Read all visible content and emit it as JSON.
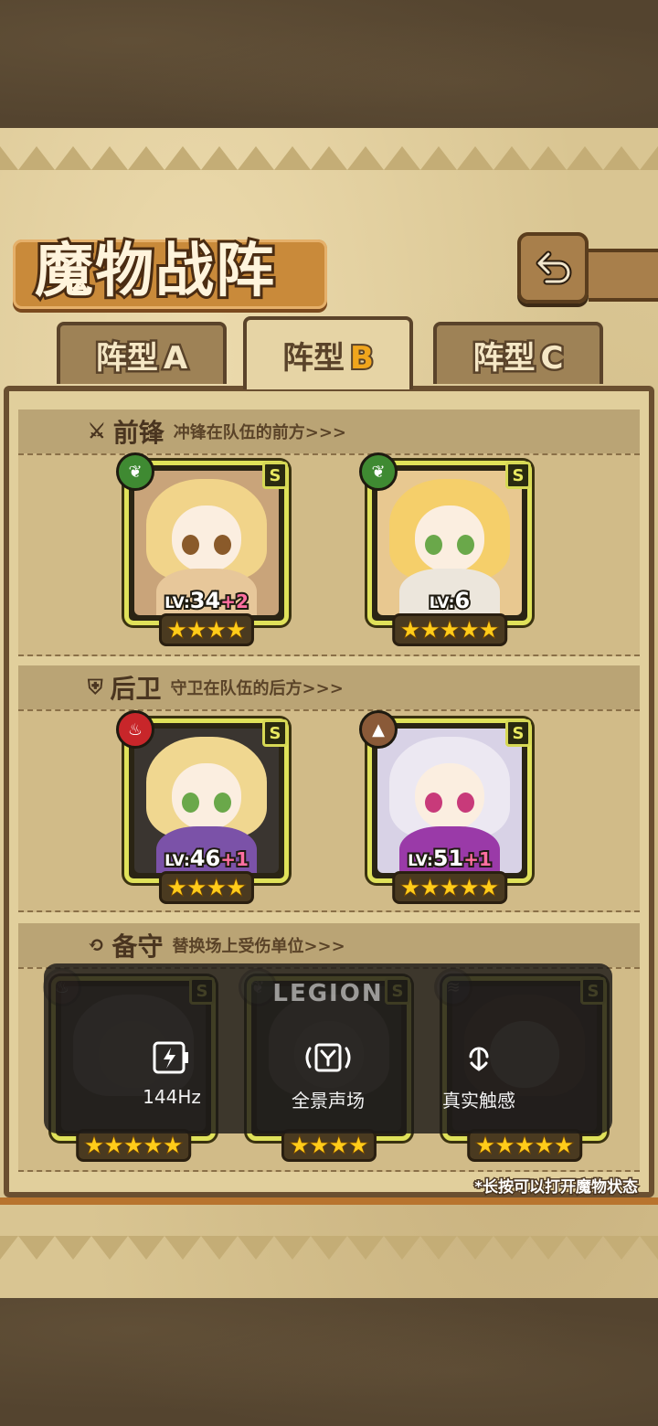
{
  "title": "魔物战阵",
  "tabs": [
    {
      "prefix": "阵型",
      "suffix": "A"
    },
    {
      "prefix": "阵型",
      "suffix": "B"
    },
    {
      "prefix": "阵型",
      "suffix": "C"
    }
  ],
  "active_tab": 1,
  "sections": {
    "front": {
      "title": "前锋",
      "desc": "冲锋在队伍的前方>>>"
    },
    "rear": {
      "title": "后卫",
      "desc": "守卫在队伍的后方>>>"
    },
    "reserve": {
      "title": "备守",
      "desc": "替换场上受伤单位>>>"
    }
  },
  "front_cards": [
    {
      "element": "leaf",
      "rank": "S",
      "level_prefix": "LV:",
      "level": "34",
      "plus": "+2",
      "stars": 4
    },
    {
      "element": "leaf",
      "rank": "S",
      "level_prefix": "LV:",
      "level": "6",
      "plus": "",
      "stars": 5
    }
  ],
  "rear_cards": [
    {
      "element": "fire",
      "rank": "S",
      "level_prefix": "LV:",
      "level": "46",
      "plus": "+1",
      "stars": 4
    },
    {
      "element": "earth",
      "rank": "S",
      "level_prefix": "LV:",
      "level": "51",
      "plus": "+1",
      "stars": 5
    }
  ],
  "reserve_cards": [
    {
      "element": "fire",
      "rank": "S",
      "stars": 5
    },
    {
      "element": "leaf",
      "rank": "S",
      "stars": 4
    },
    {
      "element": "water",
      "rank": "S",
      "stars": 5
    }
  ],
  "overlay": {
    "brand": "LEGION",
    "items": [
      {
        "icon": "battery-icon",
        "label": "144Hz"
      },
      {
        "icon": "surround-sound-icon",
        "label": "全景声场"
      },
      {
        "icon": "touch-icon",
        "label": "真实触感"
      }
    ]
  },
  "footnote": "*长按可以打开魔物状态",
  "colors": {
    "parchment": "#d9c592",
    "frame": "#6a4f30",
    "card_border": "#e0e25a",
    "star": "#ffcc1a",
    "tab_accent": "#f0a51c"
  }
}
